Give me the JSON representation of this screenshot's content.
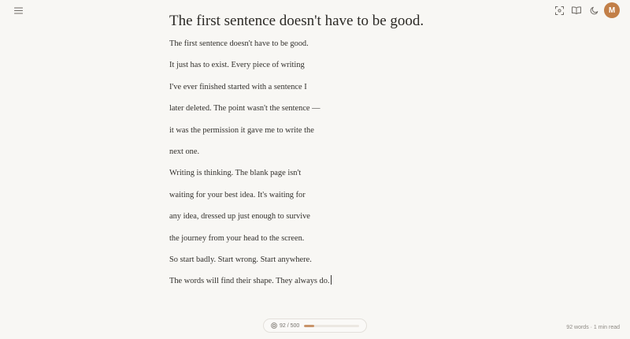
{
  "header": {
    "menu_icon": "hamburger-menu-icon",
    "focus_icon": "focus-mode-icon",
    "reading_icon": "open-book-icon",
    "theme_icon": "moon-icon",
    "avatar_initial": "M",
    "avatar_color": "#c27f48"
  },
  "document": {
    "title": "The first sentence doesn't have to be good.",
    "lines": [
      "The first sentence doesn't have to be good.",
      "It just has to exist. Every piece of writing",
      "I've ever finished started with a sentence I",
      "later deleted. The point wasn't the sentence —",
      "it was the permission it gave me to write the",
      "next one.",
      "Writing is thinking. The blank page isn't",
      "waiting for your best idea. It's waiting for",
      "any idea, dressed up just enough to survive",
      "the journey from your head to the screen.",
      "So start badly. Start wrong. Start anywhere.",
      "The words will find their shape. They always do."
    ]
  },
  "footer": {
    "goal_icon": "target-icon",
    "goal_text": "92 / 500",
    "goal_progress": 0.184,
    "goal_color": "#c9946a",
    "stats": "92 words · 1 min read"
  }
}
